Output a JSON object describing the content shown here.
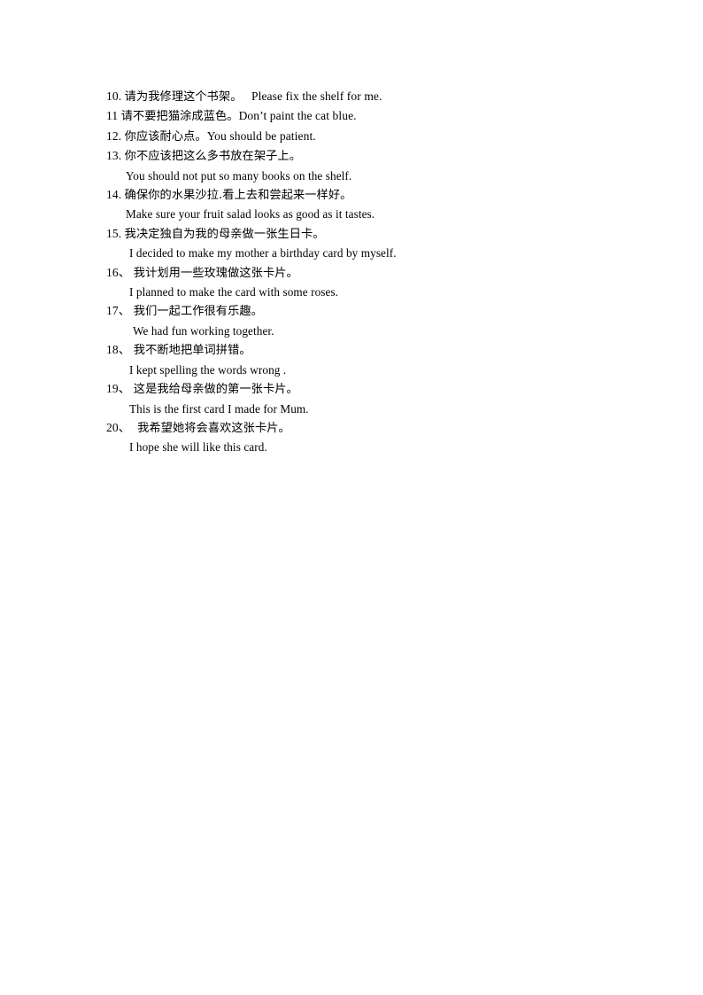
{
  "document": {
    "page_background": "#ffffff",
    "text_color": "#000000",
    "entries": [
      {
        "number": "10.",
        "chinese": "请为我修理这个书架。",
        "gap": "   ",
        "english_inline": "Please fix the shelf for me.",
        "english_below": "",
        "indent": ""
      },
      {
        "number": "11",
        "chinese": "请不要把猫涂成蓝色。",
        "gap": "",
        "english_inline": "Don’t paint the cat blue.",
        "english_below": "",
        "indent": ""
      },
      {
        "number": "12.",
        "chinese": "你应该耐心点。",
        "gap": "",
        "english_inline": "You should be patient.",
        "english_below": "",
        "indent": ""
      },
      {
        "number": "13.",
        "chinese": "你不应该把这么多书放在架子上。",
        "gap": "",
        "english_inline": "",
        "english_below": "You should not put so many books on the shelf.",
        "indent": "trans-a"
      },
      {
        "number": "14.",
        "chinese": "确保你的水果沙拉.看上去和尝起来一样好。",
        "gap": "",
        "english_inline": "",
        "english_below": "Make sure your fruit salad looks as good as it tastes.",
        "indent": "trans-a"
      },
      {
        "number": "15.",
        "chinese": "我决定独自为我的母亲做一张生日卡。",
        "gap": "",
        "english_inline": "",
        "english_below": "I decided to make my mother a birthday card by myself.",
        "indent": "trans-b"
      },
      {
        "number": "16、",
        "chinese": "我计划用一些玫瑰做这张卡片。",
        "gap": "",
        "english_inline": "",
        "english_below": "I planned to make the card with some roses.",
        "indent": "trans-b"
      },
      {
        "number": "17、",
        "chinese": "我们一起工作很有乐趣。",
        "gap": "",
        "english_inline": "",
        "english_below": "We had fun working together.",
        "indent": "trans-c"
      },
      {
        "number": "18、",
        "chinese": "我不断地把单词拼错。",
        "gap": "",
        "english_inline": "",
        "english_below": "I kept spelling the words wrong .",
        "indent": "trans-b"
      },
      {
        "number": "19、",
        "chinese": "这是我给母亲做的第一张卡片。",
        "gap": "",
        "english_inline": "",
        "english_below": "This is the first card I made for Mum.",
        "indent": "trans-b"
      },
      {
        "number": "20、",
        "chinese": " 我希望她将会喜欢这张卡片。",
        "gap": "",
        "english_inline": "",
        "english_below": "I hope she will like this card.",
        "indent": "trans-b"
      }
    ]
  }
}
